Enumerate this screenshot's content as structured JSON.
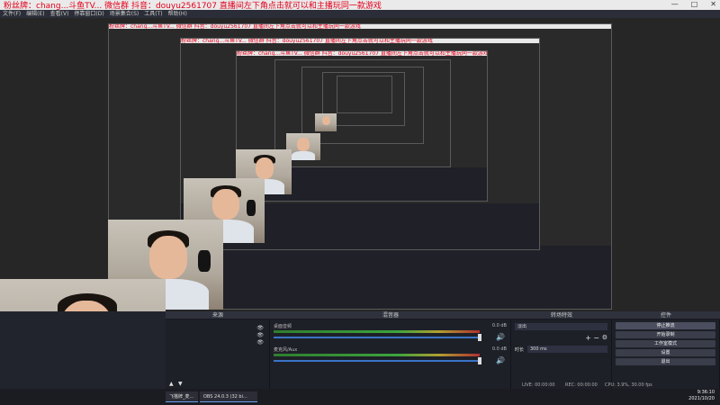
{
  "titlebar": {
    "text": "粉丝牌：chang...斗鱼TV... 微信群  抖音：douyu2561707    直播间左下角点击就可以和主播玩同一款游戏",
    "controls": [
      "—",
      "□",
      "✕"
    ]
  },
  "menu": [
    "文件(F)",
    "编辑(E)",
    "查看(V)",
    "停靠窗口(D)",
    "场景集合(S)",
    "工具(T)",
    "帮助(H)"
  ],
  "docks": {
    "sources_title": "来源",
    "mixer_title": "混音器",
    "transitions_title": "转场特效",
    "controls_title": "控件",
    "mixer": [
      {
        "label": "桌面音频",
        "db": "0.0 dB"
      },
      {
        "label": "麦克风/Aux",
        "db": "0.0 dB"
      }
    ],
    "transition": {
      "name": "淡出",
      "duration_label": "时长",
      "duration": "300 ms"
    },
    "controls": [
      "停止推流",
      "开始录制",
      "工作室模式",
      "设置",
      "退出"
    ]
  },
  "statusbar": {
    "live": "LIVE: 00:00:00",
    "rec": "REC: 00:00:00",
    "cpu": "CPU: 3.9%, 30.00 fps"
  },
  "taskbar": {
    "item1": "飞猫牌_麦...",
    "item2": "OBS 24.0.3 (32 bi..."
  },
  "clock": {
    "time": "9:36:10",
    "date": "2021/10/20"
  },
  "colors": {
    "title_red": "#e3001b",
    "accent": "#3a74c8"
  }
}
